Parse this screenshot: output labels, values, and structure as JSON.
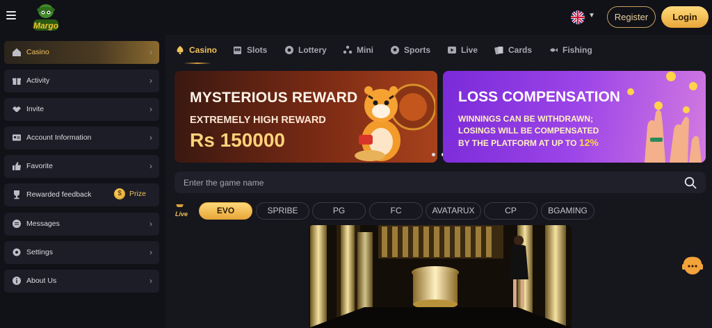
{
  "header": {
    "logo_text": "Margo",
    "language_flag": "uk-flag",
    "register_label": "Register",
    "login_label": "Login"
  },
  "sidebar": {
    "items": [
      {
        "label": "Casino",
        "icon": "home-icon",
        "active": true
      },
      {
        "label": "Activity",
        "icon": "gift-icon"
      },
      {
        "label": "Invite",
        "icon": "handshake-icon"
      },
      {
        "label": "Account Information",
        "icon": "id-card-icon"
      },
      {
        "label": "Favorite",
        "icon": "thumbs-up-icon"
      },
      {
        "label": "Rewarded feedback",
        "icon": "trophy-icon",
        "badge": "Prize"
      },
      {
        "label": "Messages",
        "icon": "message-icon"
      },
      {
        "label": "Settings",
        "icon": "settings-icon"
      },
      {
        "label": "About Us",
        "icon": "info-icon"
      }
    ],
    "prize_coin": "$"
  },
  "categories": [
    {
      "label": "Casino",
      "icon": "spade-icon",
      "active": true
    },
    {
      "label": "Slots",
      "icon": "slot-machine-icon"
    },
    {
      "label": "Lottery",
      "icon": "lottery-ball-icon"
    },
    {
      "label": "Mini",
      "icon": "mini-games-icon"
    },
    {
      "label": "Sports",
      "icon": "soccer-ball-icon"
    },
    {
      "label": "Live",
      "icon": "play-icon"
    },
    {
      "label": "Cards",
      "icon": "cards-icon"
    },
    {
      "label": "Fishing",
      "icon": "fish-icon"
    }
  ],
  "banners": {
    "banner1": {
      "title": "MYSTERIOUS REWARD",
      "subtitle": "EXTREMELY HIGH REWARD",
      "amount": "Rs 150000"
    },
    "banner2": {
      "title": "LOSS COMPENSATION",
      "line1": "WINNINGS CAN BE WITHDRAWN;",
      "line2": "LOSINGS WILL BE COMPENSATED",
      "line3_prefix": "BY THE PLATFORM AT UP TO",
      "line3_highlight": "12%"
    }
  },
  "search": {
    "placeholder": "Enter the game name"
  },
  "live_badge": "Live",
  "providers": [
    {
      "label": "EVO",
      "active": true
    },
    {
      "label": "SPRIBE"
    },
    {
      "label": "PG"
    },
    {
      "label": "FC"
    },
    {
      "label": "AVATARUX"
    },
    {
      "label": "CP"
    },
    {
      "label": "BGAMING"
    }
  ]
}
